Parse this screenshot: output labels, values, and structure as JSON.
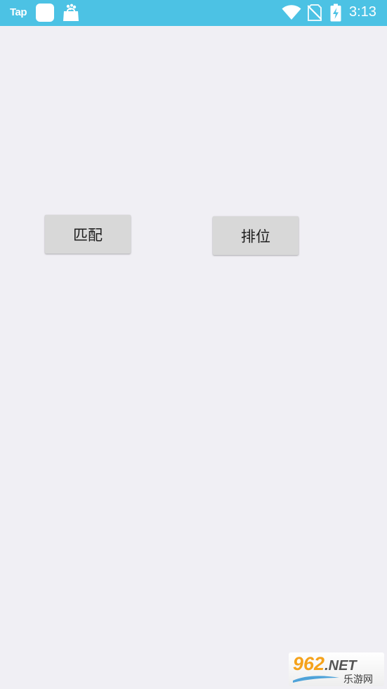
{
  "status_bar": {
    "app_label": "Tap",
    "time": "3:13",
    "background_color": "#4cc2e4",
    "icons": [
      "tap-logo",
      "app-square-icon",
      "shopping-bag-icon",
      "wifi-icon",
      "no-sim-icon",
      "battery-charging-icon"
    ]
  },
  "buttons": {
    "match_label": "匹配",
    "rank_label": "排位"
  },
  "watermark": {
    "brand_number": "962",
    "brand_suffix": ".NET",
    "site_name": "乐游网"
  },
  "colors": {
    "page_background": "#f0eff4",
    "button_background": "#d8d8d8",
    "watermark_accent": "#f5a21b"
  }
}
